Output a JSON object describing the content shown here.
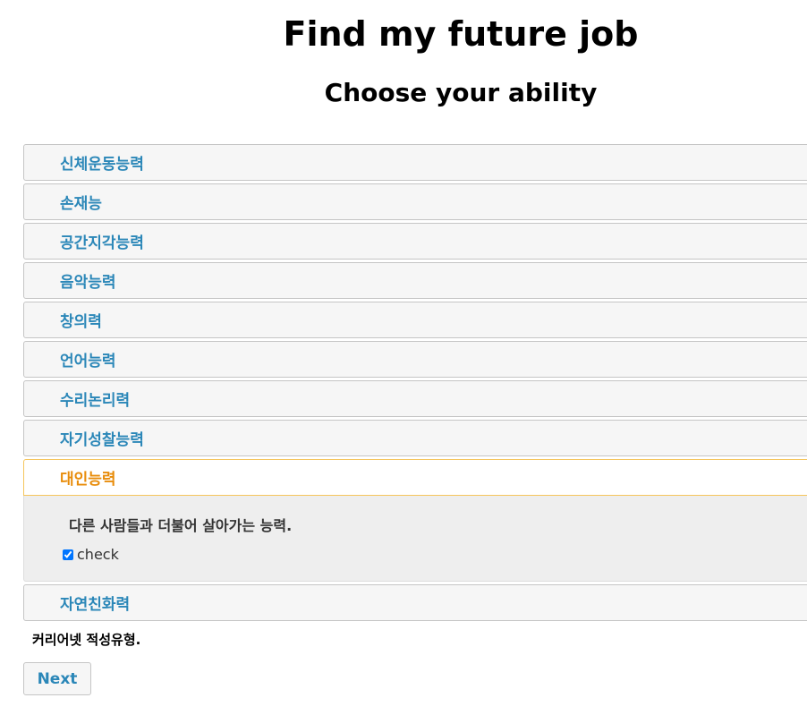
{
  "header": {
    "title": "Find my future job",
    "subtitle": "Choose your ability"
  },
  "accordion": {
    "items": [
      {
        "label": "신체운동능력"
      },
      {
        "label": "손재능"
      },
      {
        "label": "공간지각능력"
      },
      {
        "label": "음악능력"
      },
      {
        "label": "창의력"
      },
      {
        "label": "언어능력"
      },
      {
        "label": "수리논리력"
      },
      {
        "label": "자기성찰능력"
      },
      {
        "label": "대인능력"
      },
      {
        "label": "자연친화력"
      }
    ],
    "active_panel": {
      "description": "다른 사람들과 더불어 살아가는 능력.",
      "checkbox_label": "check",
      "checked": true
    }
  },
  "footer": {
    "note": "커리어넷 적성유형.",
    "next_label": "Next"
  },
  "colors": {
    "link": "#2b87b8",
    "active": "#e88c0a",
    "active_border": "#f5c55c"
  }
}
